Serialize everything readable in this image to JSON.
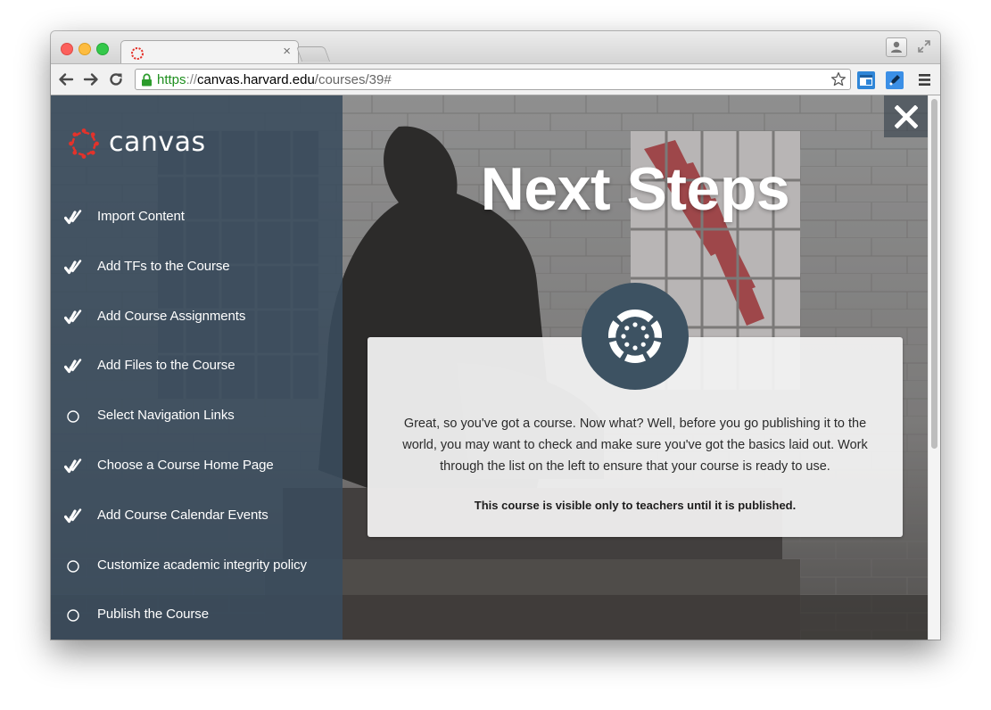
{
  "browser": {
    "url_scheme": "https",
    "url_separator": "://",
    "url_host": "canvas.harvard.edu",
    "url_path": "/courses/39#",
    "tab_close_glyph": "×"
  },
  "sidebar": {
    "logo_text": "canvas",
    "steps": [
      {
        "label": "Import Content",
        "status": "complete"
      },
      {
        "label": "Add TFs to the Course",
        "status": "complete"
      },
      {
        "label": "Add Course Assignments",
        "status": "complete"
      },
      {
        "label": "Add Files to the Course",
        "status": "complete"
      },
      {
        "label": "Select Navigation Links",
        "status": "incomplete"
      },
      {
        "label": "Choose a Course Home Page",
        "status": "complete"
      },
      {
        "label": "Add Course Calendar Events",
        "status": "complete"
      },
      {
        "label": "Customize academic integrity policy",
        "status": "incomplete"
      },
      {
        "label": "Publish the Course",
        "status": "incomplete"
      }
    ]
  },
  "main": {
    "headline": "Next Steps",
    "card_text": "Great, so you've got a course. Now what? Well, before you go publishing it to the world, you may want to check and make sure you've got the basics laid out. Work through the list on the left to ensure that your course is ready to use.",
    "card_note": "This course is visible only to teachers until it is published."
  },
  "colors": {
    "sidebar_bg": "#3a4c5d",
    "badge_bg": "#3d5262",
    "canvas_red": "#e4322a",
    "secure_green": "#1e8f1e"
  },
  "icons": {
    "complete": "check-icon",
    "incomplete": "circle-icon"
  }
}
